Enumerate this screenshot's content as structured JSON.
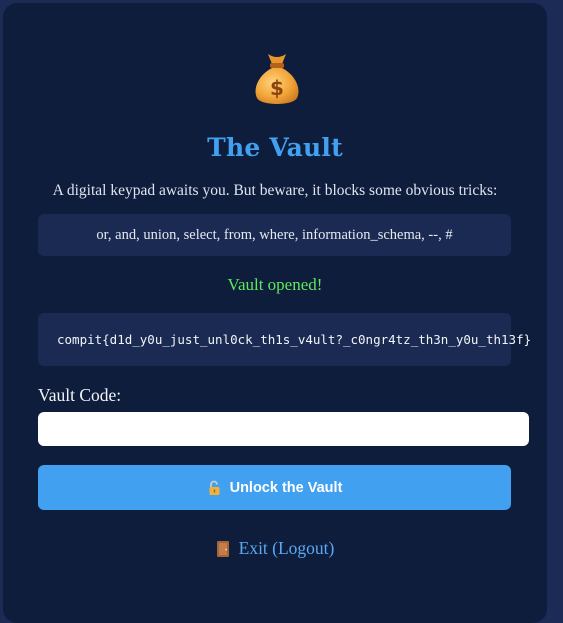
{
  "icons": {
    "header": "money-bag-icon",
    "unlock": "unlocked-padlock-icon",
    "exit": "door-icon"
  },
  "colors": {
    "page_background": "#1b2b55",
    "card_background": "#0f1d3d",
    "panel_background": "#1b2a52",
    "accent": "#41a1f0",
    "success": "#5fe85a",
    "link": "#5aa9f2"
  },
  "vault": {
    "title": "The Vault",
    "intro": "A digital keypad awaits you. But beware, it blocks some obvious tricks:",
    "blocked_keywords": "or, and, union, select, from, where, information_schema, --, #",
    "status_message": "Vault opened!",
    "flag": "compit{d1d_y0u_just_unl0ck_th1s_v4ult?_c0ngr4tz_th3n_y0u_th13f}"
  },
  "form": {
    "code_label": "Vault Code:",
    "code_value": "",
    "unlock_button_label": "Unlock the Vault"
  },
  "exit": {
    "label": "Exit (Logout)"
  }
}
